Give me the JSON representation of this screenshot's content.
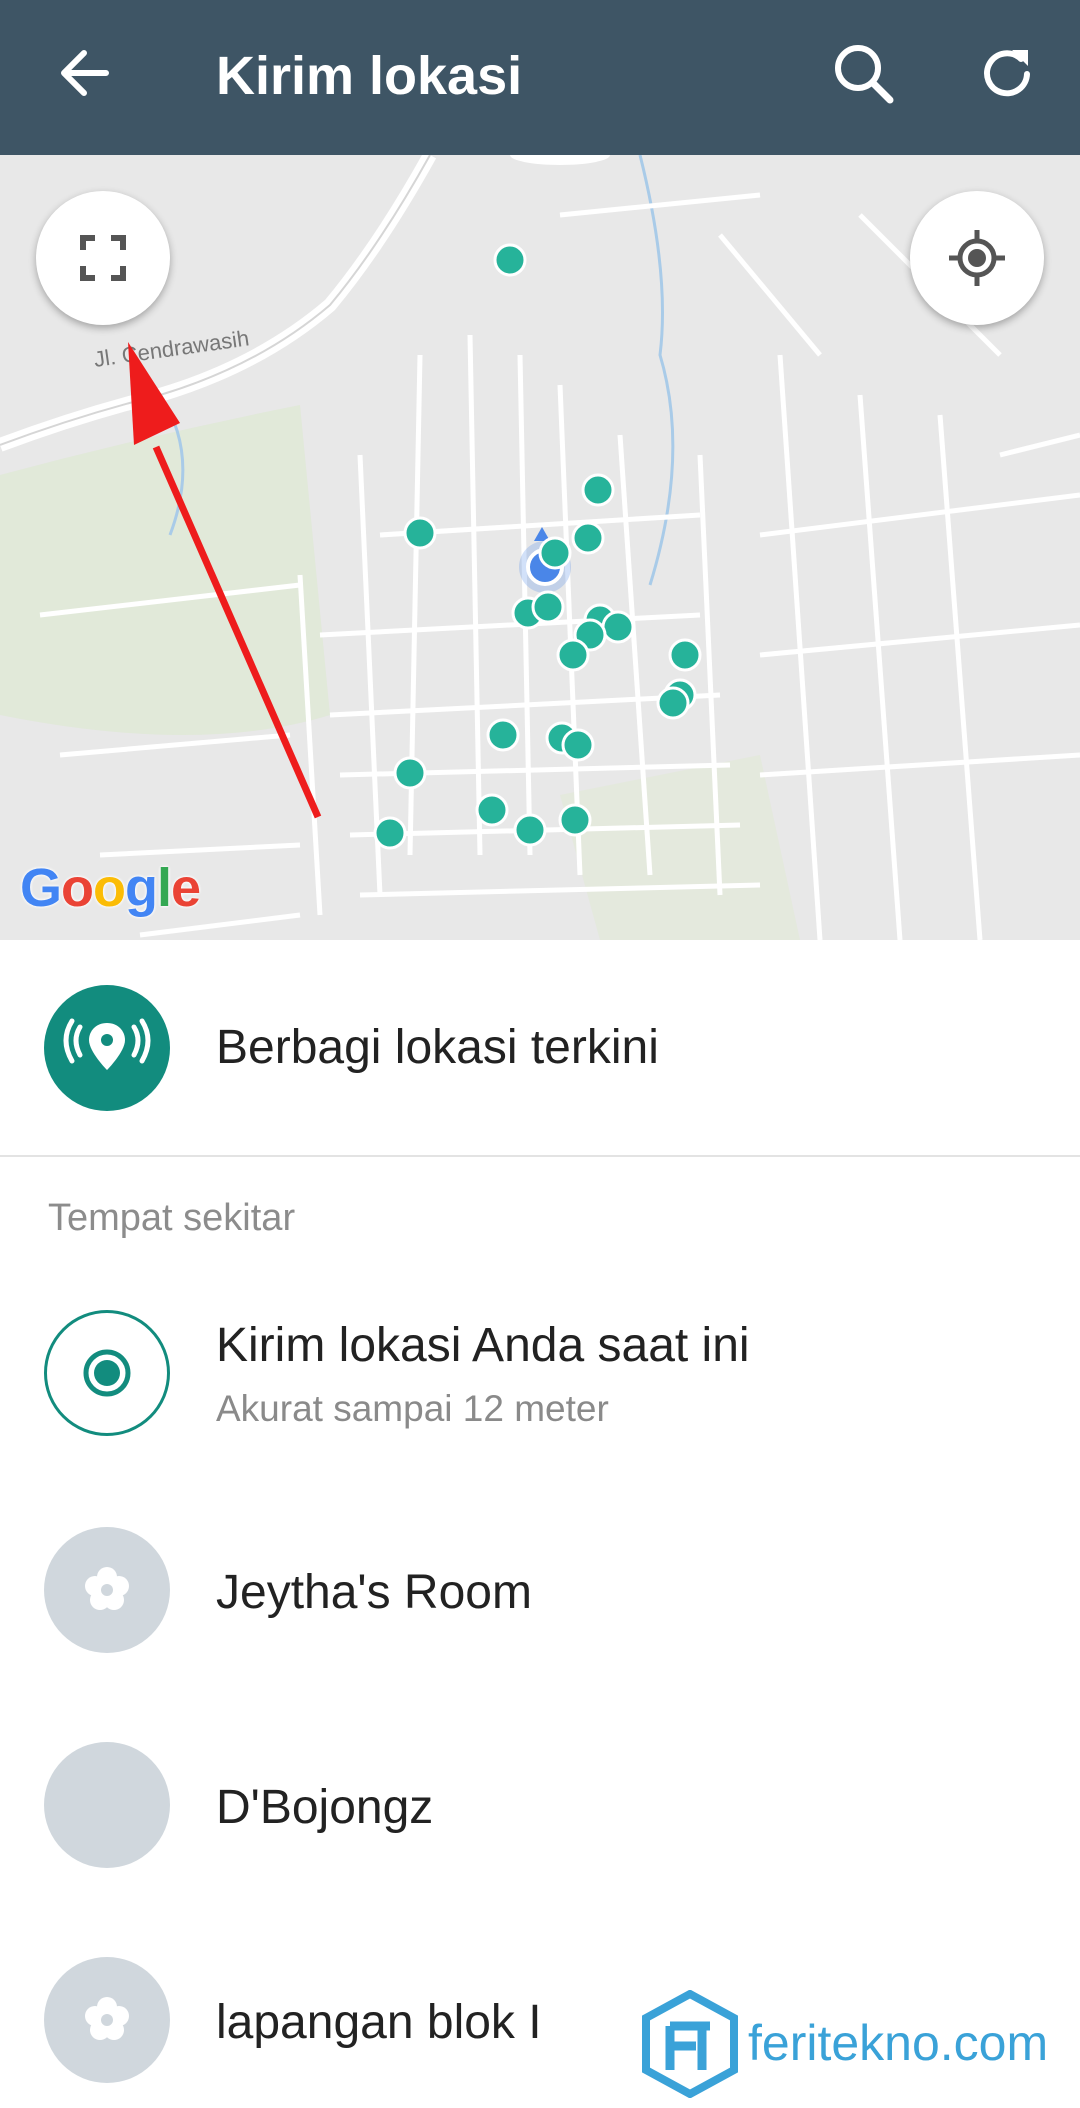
{
  "header": {
    "title": "Kirim lokasi",
    "bg_color": "#3e5565"
  },
  "map": {
    "street_label": "Jl. Cendrawasih",
    "attribution": "Google",
    "marker_color": "#26b39a",
    "user_location_color": "#4a86e8"
  },
  "live_location": {
    "label": "Berbagi lokasi terkini",
    "icon_color": "#128c7e"
  },
  "nearby": {
    "section_title": "Tempat sekitar",
    "current": {
      "label": "Kirim lokasi Anda saat ini",
      "accuracy": "Akurat sampai 12 meter"
    },
    "places": [
      {
        "name": "Jeytha's Room",
        "icon": "flower-icon"
      },
      {
        "name": "D'Bojongz",
        "icon": "blank"
      },
      {
        "name": "lapangan blok I",
        "icon": "flower-icon"
      }
    ]
  },
  "watermark": {
    "text": "feritekno.com"
  }
}
